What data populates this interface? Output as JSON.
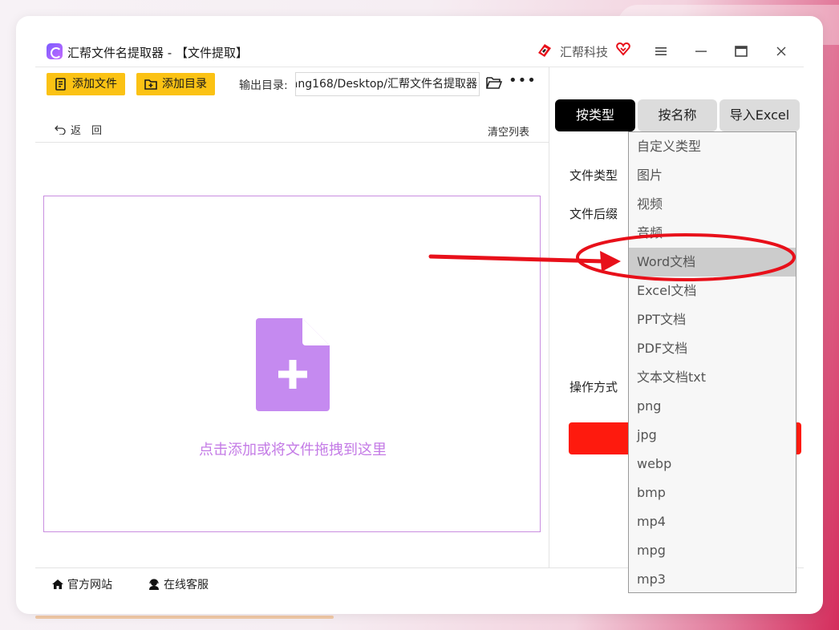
{
  "window": {
    "title": "汇帮文件名提取器 - 【文件提取】",
    "brand": "汇帮科技"
  },
  "toolbar": {
    "add_file": "添加文件",
    "add_dir": "添加目录",
    "output_label": "输出目录:",
    "output_path": "ang168/Desktop/汇帮文件名提取器",
    "back": "返　回",
    "clear": "清空列表"
  },
  "dropzone": {
    "hint": "点击添加或将文件拖拽到这里"
  },
  "panel": {
    "tabs": [
      "按类型",
      "按名称",
      "导入Excel"
    ],
    "active_tab": "按类型",
    "file_type_label": "文件类型",
    "file_suffix_label": "文件后缀",
    "operation_label": "操作方式"
  },
  "dropdown": {
    "items": [
      "自定义类型",
      "图片",
      "视频",
      "音频",
      "Word文档",
      "Excel文档",
      "PPT文档",
      "PDF文档",
      "文本文档txt",
      "png",
      "jpg",
      "webp",
      "bmp",
      "mp4",
      "mpg",
      "mp3"
    ],
    "selected": "Word文档"
  },
  "footer": {
    "site": "官方网站",
    "service": "在线客服"
  },
  "colors": {
    "accent_yellow": "#fbc214",
    "drop_purple": "#c47be6",
    "action_red": "#fe1a0e",
    "annotation_red": "#e8101a"
  },
  "icons": [
    "app-logo-icon",
    "brand-icon",
    "heart-icon",
    "menu-icon",
    "minimize-icon",
    "maximize-icon",
    "close-icon",
    "add-file-icon",
    "add-folder-icon",
    "folder-open-icon",
    "more-icon",
    "undo-icon",
    "add-document-icon",
    "home-icon",
    "headset-icon"
  ]
}
